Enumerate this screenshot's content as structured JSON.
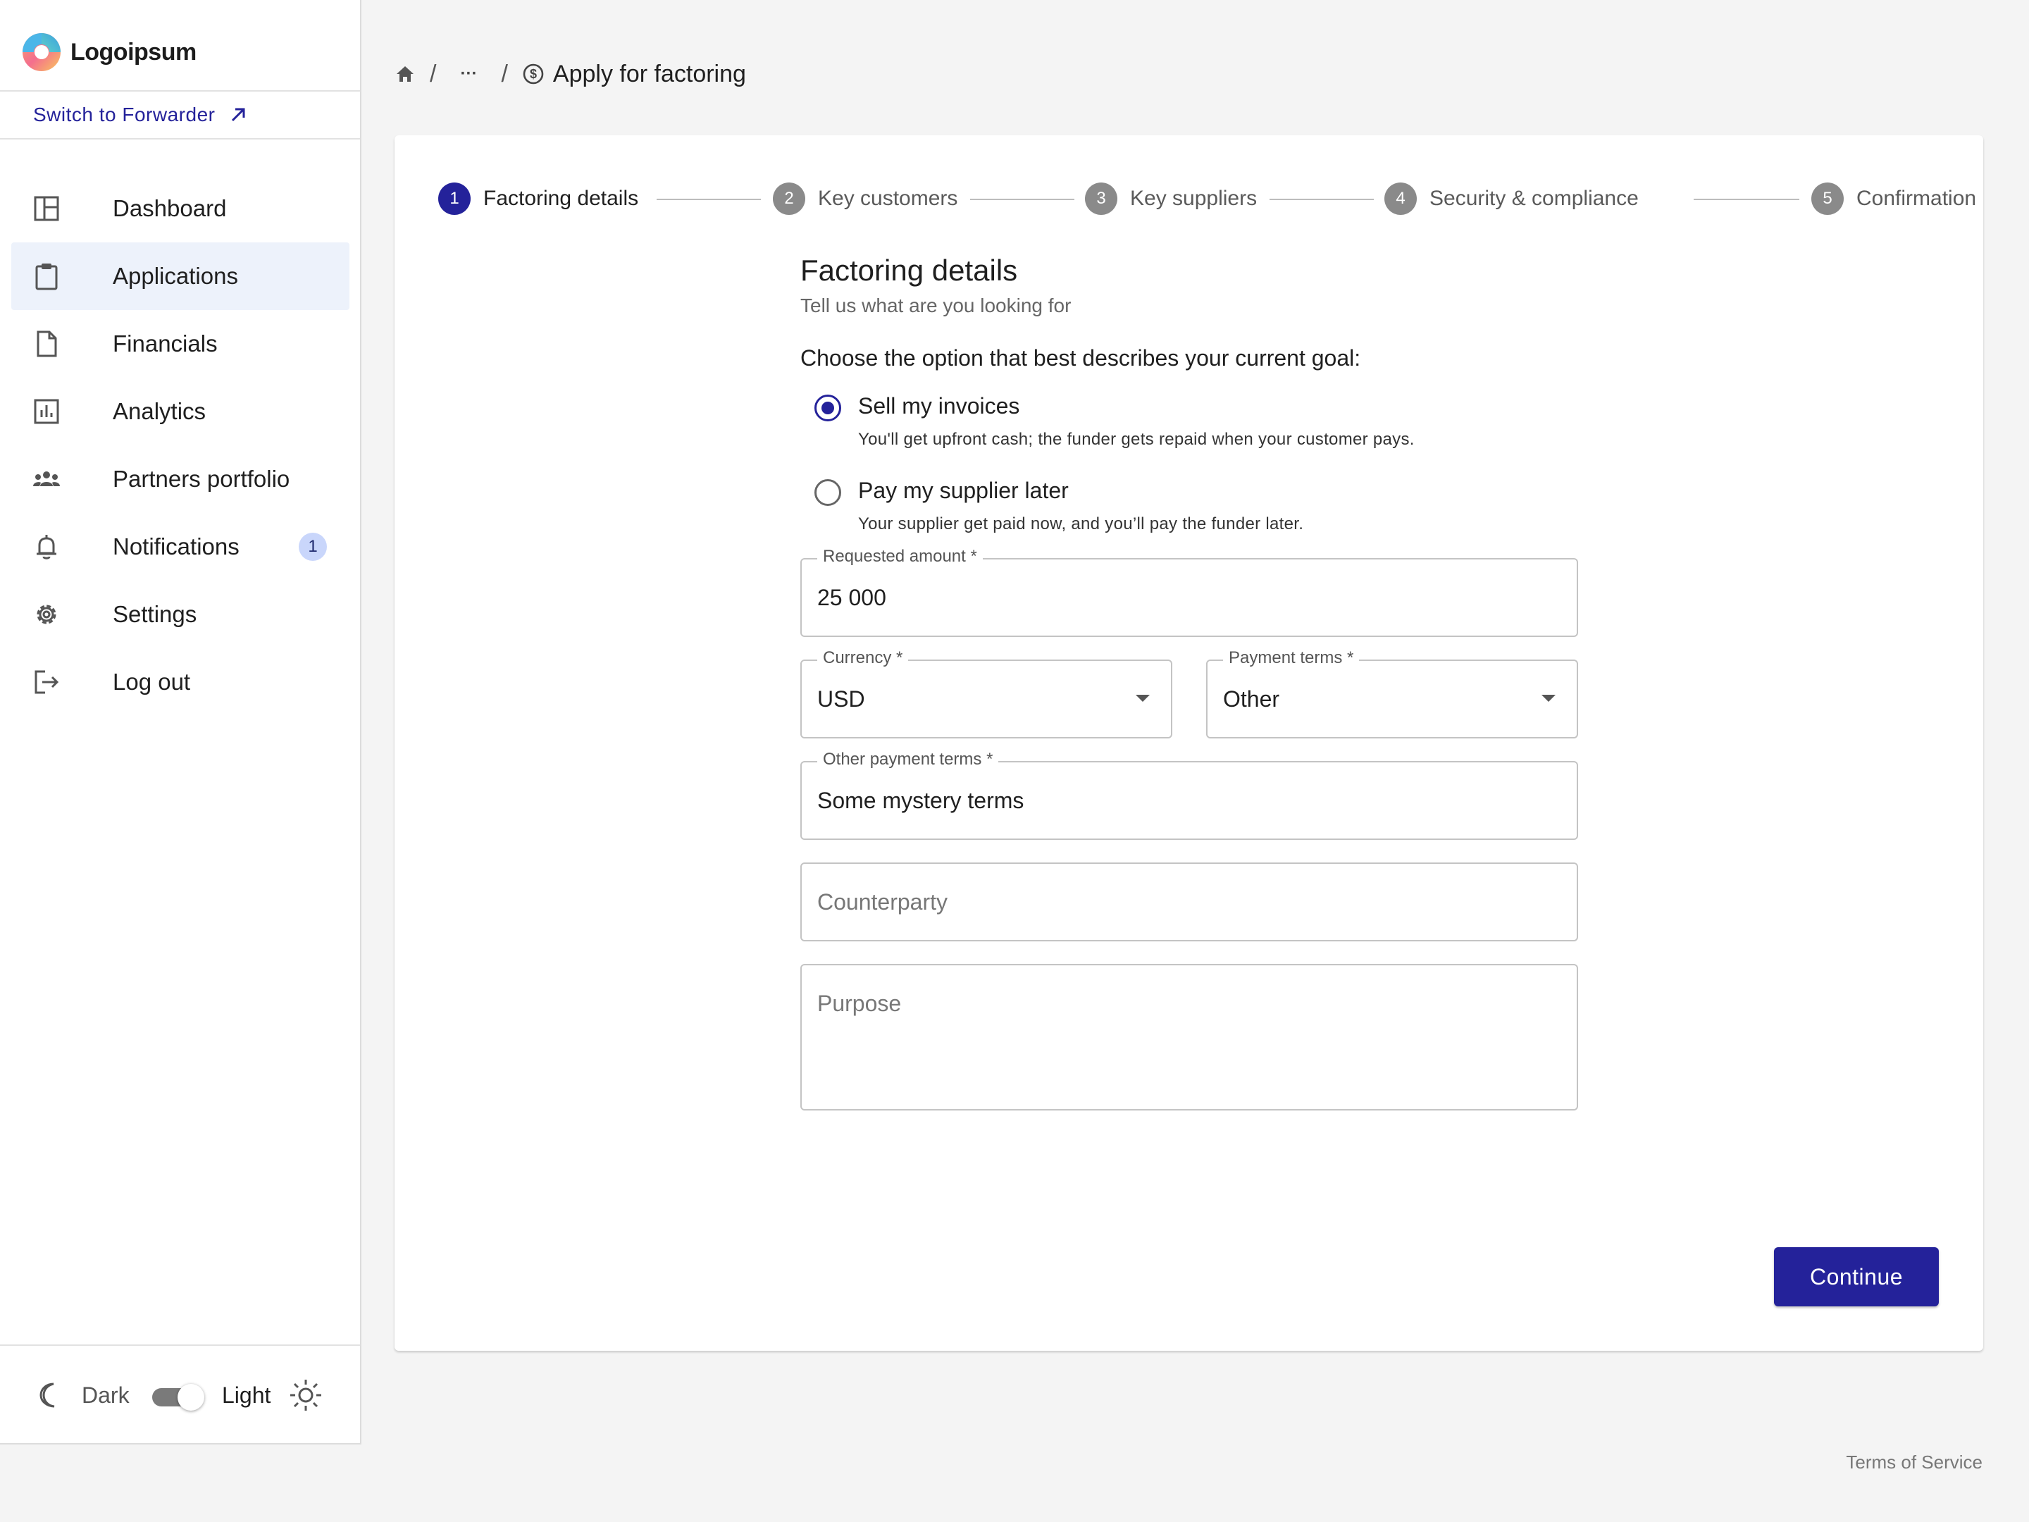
{
  "brand": {
    "name": "Logoipsum"
  },
  "sidebar": {
    "switch_label": "Switch to Forwarder",
    "items": [
      {
        "label": "Dashboard",
        "icon": "dashboard-icon"
      },
      {
        "label": "Applications",
        "icon": "clipboard-icon",
        "active": true
      },
      {
        "label": "Financials",
        "icon": "document-icon"
      },
      {
        "label": "Analytics",
        "icon": "bar-chart-icon"
      },
      {
        "label": "Partners portfolio",
        "icon": "group-icon"
      },
      {
        "label": "Notifications",
        "icon": "bell-icon",
        "badge": "1"
      },
      {
        "label": "Settings",
        "icon": "gear-icon"
      },
      {
        "label": "Log out",
        "icon": "logout-icon"
      }
    ],
    "theme": {
      "dark_label": "Dark",
      "light_label": "Light",
      "mode": "light"
    }
  },
  "breadcrumb": {
    "ellipsis": "···",
    "separator": "/",
    "current": "Apply for factoring"
  },
  "stepper": {
    "steps": [
      {
        "num": "1",
        "label": "Factoring details",
        "active": true
      },
      {
        "num": "2",
        "label": "Key customers"
      },
      {
        "num": "3",
        "label": "Key suppliers"
      },
      {
        "num": "4",
        "label": "Security & compliance"
      },
      {
        "num": "5",
        "label": "Confirmation"
      }
    ]
  },
  "form": {
    "title": "Factoring details",
    "subtitle": "Tell us what are you looking for",
    "question": "Choose the option that best describes your current goal:",
    "options": [
      {
        "label": "Sell my invoices",
        "description": "You'll get upfront cash; the funder gets repaid when your customer pays.",
        "checked": true
      },
      {
        "label": "Pay my supplier later",
        "description": "Your supplier get paid now, and you’ll pay the funder later.",
        "checked": false
      }
    ],
    "requested_amount": {
      "label": "Requested amount *",
      "value": "25 000"
    },
    "currency": {
      "label": "Currency *",
      "value": "USD"
    },
    "payment_terms": {
      "label": "Payment terms *",
      "value": "Other"
    },
    "other_payment_terms": {
      "label": "Other payment terms *",
      "value": "Some mystery terms"
    },
    "counterparty": {
      "placeholder": "Counterparty"
    },
    "purpose": {
      "placeholder": "Purpose"
    },
    "continue_label": "Continue"
  },
  "footer": {
    "terms": "Terms of Service"
  },
  "colors": {
    "primary": "#24229a",
    "active_bg": "#edf2fb",
    "badge_bg": "#c9d6fb",
    "background": "#f4f4f4"
  }
}
